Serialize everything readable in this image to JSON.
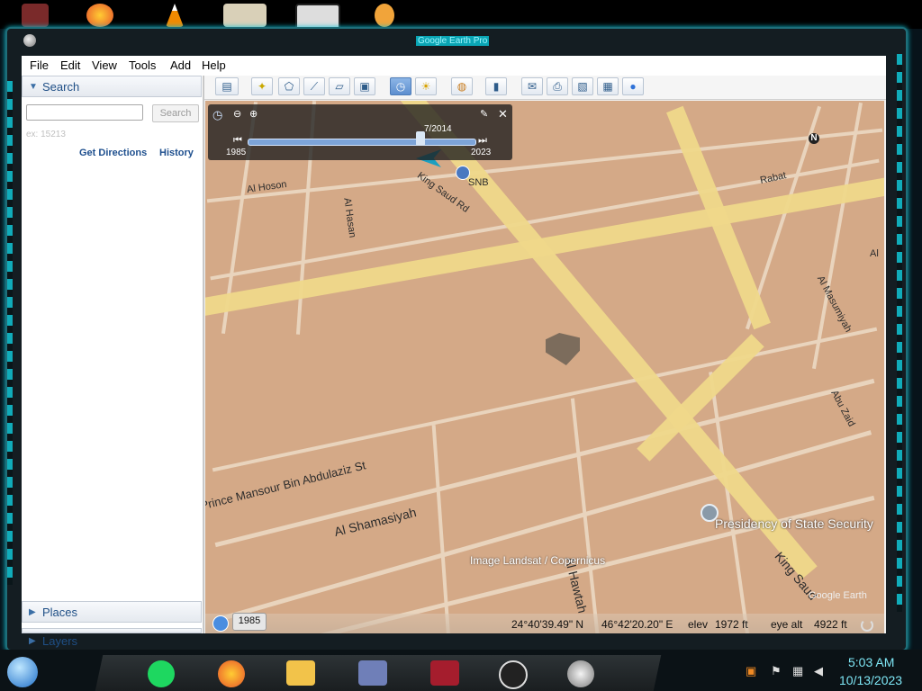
{
  "window": {
    "title": "Google Earth Pro"
  },
  "menu": [
    {
      "label": "File"
    },
    {
      "label": "Edit"
    },
    {
      "label": "View"
    },
    {
      "label": "Tools"
    },
    {
      "label": "Add"
    },
    {
      "label": "Help"
    }
  ],
  "search_panel": {
    "header": "Search",
    "input_value": "",
    "button_label": "Search",
    "hint": "ex: 15213",
    "get_directions": "Get Directions",
    "history": "History"
  },
  "places": {
    "label": "Places"
  },
  "layers": {
    "label": "Layers"
  },
  "toolbar": {
    "icons": [
      "sidebar-toggle-icon",
      "placemark-icon",
      "polygon-icon",
      "path-icon",
      "image-overlay-icon",
      "record-tour-icon",
      "historical-imagery-icon",
      "sun-icon",
      "planets-icon",
      "ruler-icon",
      "email-icon",
      "print-icon",
      "save-image-icon",
      "map-icon",
      "globe-icon"
    ]
  },
  "timeline": {
    "current": "7/2014",
    "start_year": "1985",
    "end_year": "2023",
    "position": 0.76
  },
  "map": {
    "labels": {
      "al_hoson": "Al Hoson",
      "al_hasan": "Al Hasan",
      "king_saud_rd": "King Saud Rd",
      "snb": "SNB",
      "rabat": "Rabat",
      "al_masumi": "Al Masumiyah",
      "abu_zaid": "Abu Zaid",
      "prince_mansour": "Prince Mansour Bin Abdulaziz St",
      "al_shamasiyah": "Al Shamasiyah",
      "presidency": "Presidency of State Security",
      "king_saud2": "King Saud",
      "al_hawtah": "Al Hawtah",
      "image_credit": "Image Landsat / Copernicus",
      "ge_watermark": "Google Earth",
      "al": "Al"
    }
  },
  "status": {
    "year_chip": "1985",
    "lat": "24°40'39.49\" N",
    "lon": "46°42'20.20\" E",
    "elev_label": "elev",
    "elev": "1972 ft",
    "eye_label": "eye alt",
    "eye_alt": "4922 ft"
  },
  "taskbar": {
    "time": "5:03 AM",
    "date": "10/13/2023"
  }
}
